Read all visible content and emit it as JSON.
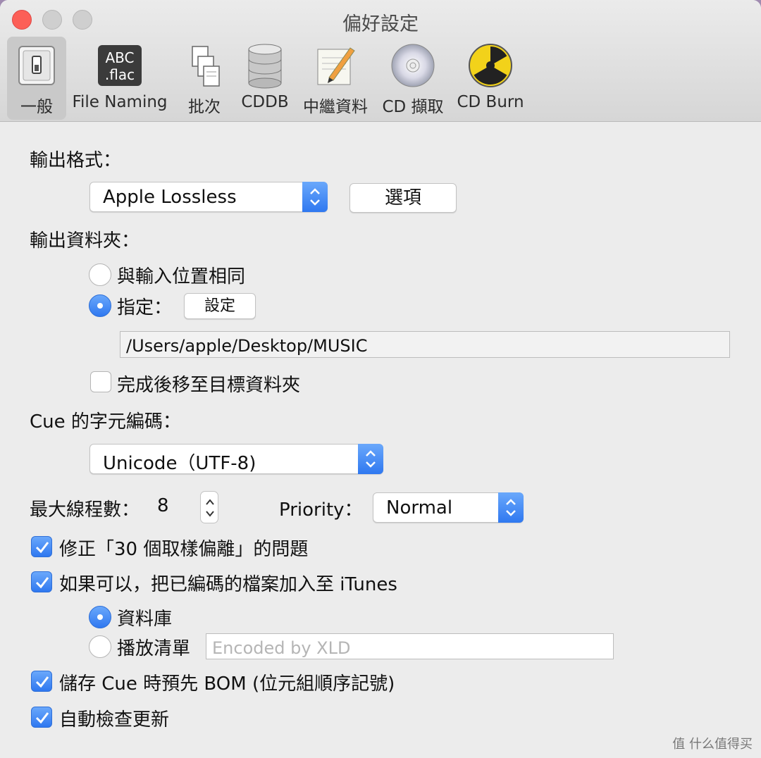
{
  "window": {
    "title": "偏好設定"
  },
  "toolbar": {
    "items": [
      {
        "label": "一般",
        "icon": "switch-icon",
        "selected": true
      },
      {
        "label": "File Naming",
        "icon": "abc-flac-icon",
        "icon_text_1": "ABC",
        "icon_text_2": ".flac"
      },
      {
        "label": "批次",
        "icon": "documents-icon"
      },
      {
        "label": "CDDB",
        "icon": "database-icon"
      },
      {
        "label": "中繼資料",
        "icon": "pencil-document-icon"
      },
      {
        "label": "CD 擷取",
        "icon": "cd-icon"
      },
      {
        "label": "CD Burn",
        "icon": "burn-icon"
      }
    ]
  },
  "output_format": {
    "label": "輸出格式：",
    "selected": "Apple Lossless",
    "options_button": "選項"
  },
  "output_folder": {
    "label": "輸出資料夾：",
    "radio_same": "與輸入位置相同",
    "radio_specify": "指定：",
    "set_button": "設定",
    "path": "/Users/apple/Desktop/MUSIC",
    "move_after": "完成後移至目標資料夾"
  },
  "cue_encoding": {
    "label": "Cue 的字元編碼：",
    "selected": "Unicode（UTF-8)"
  },
  "threads": {
    "label": "最大線程數：",
    "value": "8",
    "priority_label": "Priority：",
    "priority_value": "Normal"
  },
  "options": {
    "fix_offset": "修正「30 個取樣偏離」的問題",
    "add_itunes": "如果可以，把已編碼的檔案加入至 iTunes",
    "library": "資料庫",
    "playlist": "播放清單",
    "playlist_placeholder": "Encoded by XLD",
    "save_bom": "儲存 Cue 時預先 BOM (位元組順序記號)",
    "auto_update": "自動檢查更新"
  },
  "watermark": "值 什么值得买",
  "colors": {
    "accent": "#3a82f7",
    "close": "#fc5f57"
  }
}
